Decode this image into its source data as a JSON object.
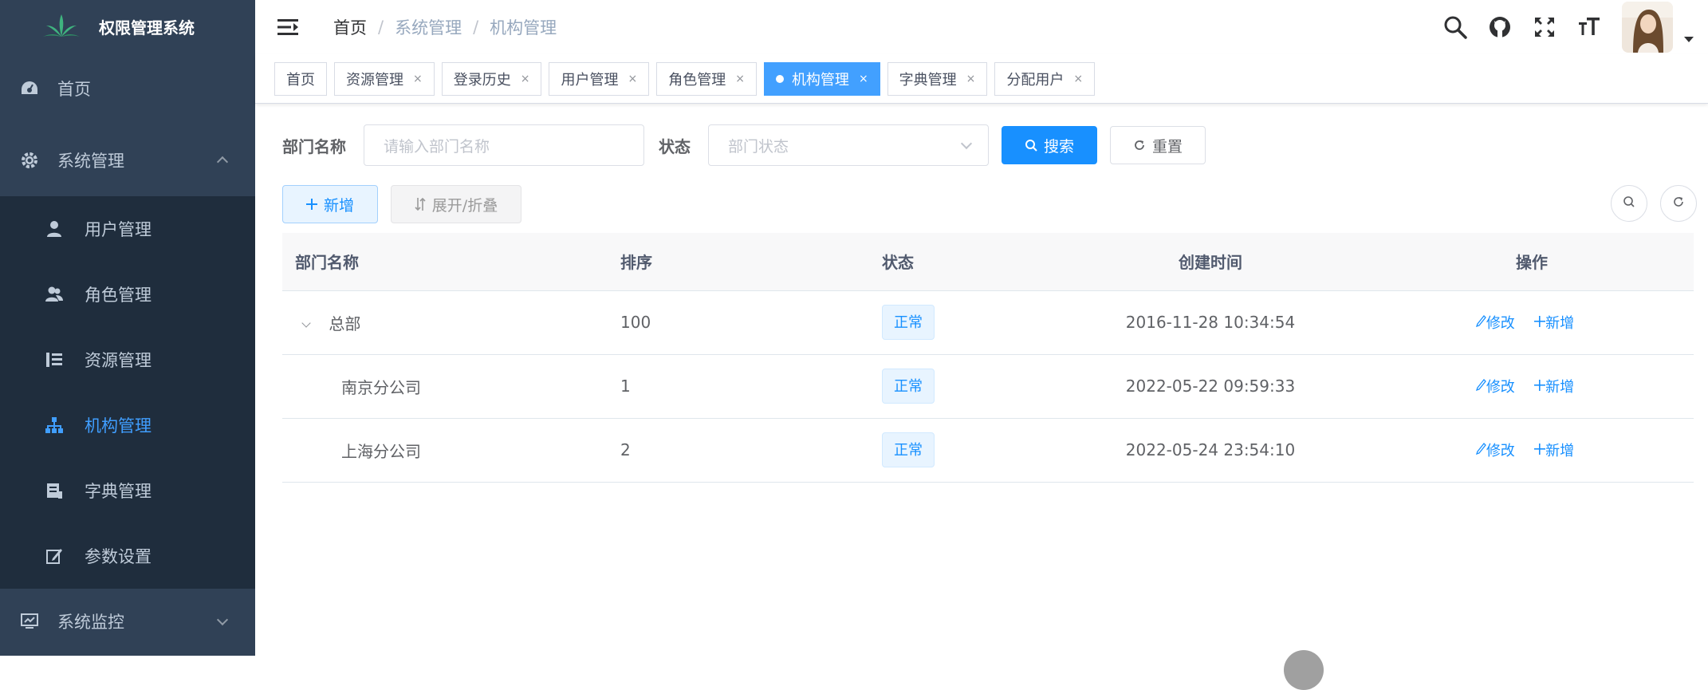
{
  "app": {
    "title": "权限管理系统"
  },
  "sidebar": {
    "items": [
      {
        "label": "首页",
        "icon": "dashboard-icon"
      },
      {
        "label": "系统管理",
        "icon": "gear-icon",
        "expanded": true,
        "children": [
          {
            "label": "用户管理",
            "icon": "user-icon"
          },
          {
            "label": "角色管理",
            "icon": "peoples-icon"
          },
          {
            "label": "资源管理",
            "icon": "tree-table-icon"
          },
          {
            "label": "机构管理",
            "icon": "org-tree-icon",
            "active": true
          },
          {
            "label": "字典管理",
            "icon": "dict-icon"
          },
          {
            "label": "参数设置",
            "icon": "edit-icon"
          }
        ]
      },
      {
        "label": "系统监控",
        "icon": "monitor-icon",
        "expanded": false
      }
    ]
  },
  "navbar": {
    "breadcrumb": [
      "首页",
      "系统管理",
      "机构管理"
    ],
    "right_icons": [
      "search-icon",
      "github-icon",
      "fullscreen-icon",
      "font-size-icon"
    ]
  },
  "tags": [
    {
      "label": "首页",
      "closable": false
    },
    {
      "label": "资源管理",
      "closable": true
    },
    {
      "label": "登录历史",
      "closable": true
    },
    {
      "label": "用户管理",
      "closable": true
    },
    {
      "label": "角色管理",
      "closable": true
    },
    {
      "label": "机构管理",
      "closable": true,
      "active": true
    },
    {
      "label": "字典管理",
      "closable": true
    },
    {
      "label": "分配用户",
      "closable": true
    }
  ],
  "close_glyph": "×",
  "search": {
    "dept_label": "部门名称",
    "dept_placeholder": "请输入部门名称",
    "status_label": "状态",
    "status_placeholder": "部门状态",
    "search_btn": "搜索",
    "reset_btn": "重置"
  },
  "toolbar": {
    "add_btn": "新增",
    "expand_btn": "展开/折叠"
  },
  "table": {
    "columns": [
      "部门名称",
      "排序",
      "状态",
      "创建时间",
      "操作"
    ],
    "rows": [
      {
        "name": "总部",
        "order": "100",
        "status": "正常",
        "created": "2016-11-28 10:34:54",
        "edit": "修改",
        "add": "新增"
      },
      {
        "name": "南京分公司",
        "order": "1",
        "status": "正常",
        "created": "2022-05-22 09:59:33",
        "edit": "修改",
        "add": "新增"
      },
      {
        "name": "上海分公司",
        "order": "2",
        "status": "正常",
        "created": "2022-05-24 23:54:10",
        "edit": "修改",
        "add": "新增"
      }
    ]
  },
  "colors": {
    "sidebar_bg": "#304156",
    "submenu_bg": "#1f2d3d",
    "primary": "#1890ff",
    "active_tag": "#42a0ff"
  }
}
